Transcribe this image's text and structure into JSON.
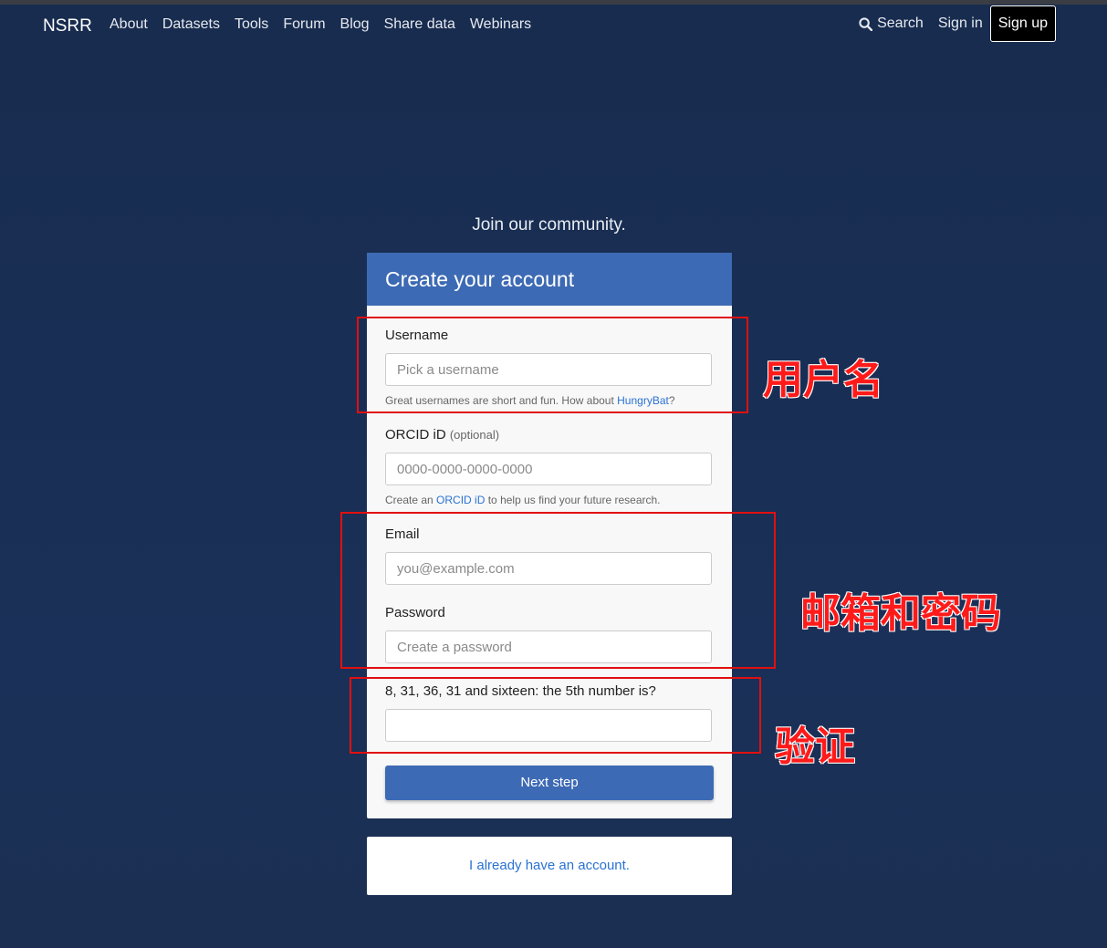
{
  "nav": {
    "brand": "NSRR",
    "links": [
      "About",
      "Datasets",
      "Tools",
      "Forum",
      "Blog",
      "Share data",
      "Webinars"
    ],
    "search": "Search",
    "sign_in": "Sign in",
    "sign_up": "Sign up"
  },
  "tagline": "Join our community.",
  "form": {
    "title": "Create your account",
    "username": {
      "label": "Username",
      "placeholder": "Pick a username",
      "help_prefix": "Great usernames are short and fun. How about ",
      "help_link": "HungryBat",
      "help_suffix": "?"
    },
    "orcid": {
      "label": "ORCID iD",
      "optional": "(optional)",
      "placeholder": "0000-0000-0000-0000",
      "help_prefix": "Create an ",
      "help_link": "ORCID iD",
      "help_suffix": " to help us find your future research."
    },
    "email": {
      "label": "Email",
      "placeholder": "you@example.com"
    },
    "password": {
      "label": "Password",
      "placeholder": "Create a password"
    },
    "captcha": {
      "label": "8, 31, 36, 31 and sixteen: the 5th number is?",
      "value": ""
    },
    "submit": "Next step"
  },
  "existing_account_link": "I already have an account.",
  "annotations": {
    "username": "用户名",
    "email_password": "邮箱和密码",
    "verification": "验证",
    "color": "#e01010"
  }
}
